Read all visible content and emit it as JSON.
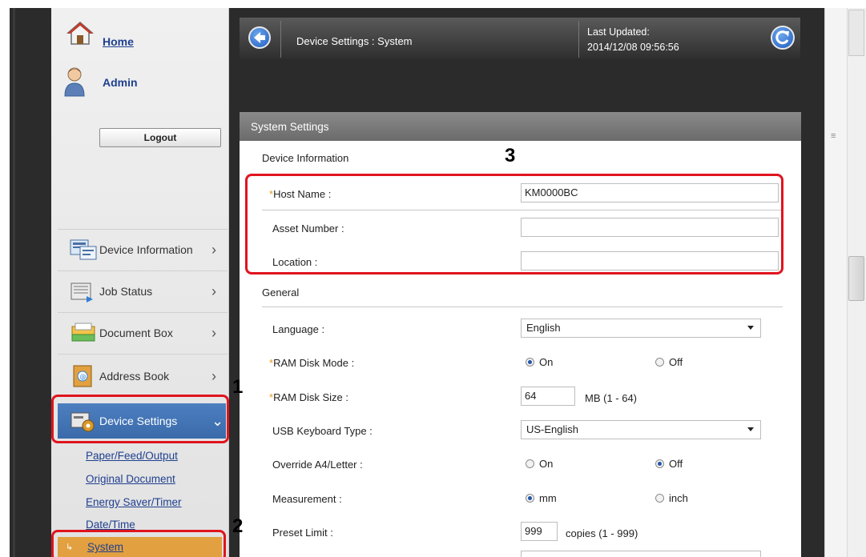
{
  "sidebar": {
    "home_label": "Home",
    "admin_label": "Admin",
    "logout_label": "Logout",
    "nav": [
      {
        "label": "Device Information",
        "icon": "device-information-icon"
      },
      {
        "label": "Job Status",
        "icon": "job-status-icon"
      },
      {
        "label": "Document Box",
        "icon": "document-box-icon"
      },
      {
        "label": "Address Book",
        "icon": "address-book-icon"
      },
      {
        "label": "Device Settings",
        "icon": "device-settings-icon"
      }
    ],
    "sublinks": [
      "Paper/Feed/Output",
      "Original Document",
      "Energy Saver/Timer",
      "Date/Time",
      "System"
    ]
  },
  "header": {
    "title": "Device Settings : System",
    "last_updated_label": "Last Updated:",
    "last_updated_value": "2014/12/08 09:56:56"
  },
  "panel": {
    "title": "System Settings",
    "device_info_label": "Device Information",
    "general_label": "General",
    "fields": {
      "host_name": {
        "label": "Host Name :",
        "value": "KM0000BC",
        "required": "*"
      },
      "asset_number": {
        "label": "Asset Number :",
        "value": ""
      },
      "location": {
        "label": "Location :",
        "value": ""
      },
      "language": {
        "label": "Language :",
        "value": "English"
      },
      "ram_disk_mode": {
        "label": "RAM Disk Mode :",
        "required": "*",
        "opt_on": "On",
        "opt_off": "Off",
        "selected": "On"
      },
      "ram_disk_size": {
        "label": "RAM Disk Size :",
        "required": "*",
        "value": "64",
        "unit": "MB (1 - 64)"
      },
      "usb_keyboard": {
        "label": "USB Keyboard Type :",
        "value": "US-English"
      },
      "override_a4": {
        "label": "Override A4/Letter :",
        "opt_on": "On",
        "opt_off": "Off",
        "selected": "Off"
      },
      "measurement": {
        "label": "Measurement :",
        "opt_mm": "mm",
        "opt_inch": "inch",
        "selected": "mm"
      },
      "preset_limit": {
        "label": "Preset Limit :",
        "value": "999",
        "unit": "copies (1 - 999)"
      }
    }
  },
  "callouts": [
    "1",
    "2",
    "3"
  ],
  "colors": {
    "highlight": "#e0141e",
    "active_nav": "#3a6aaa",
    "system_item": "#e2a040",
    "required_star": "#e59b20"
  }
}
